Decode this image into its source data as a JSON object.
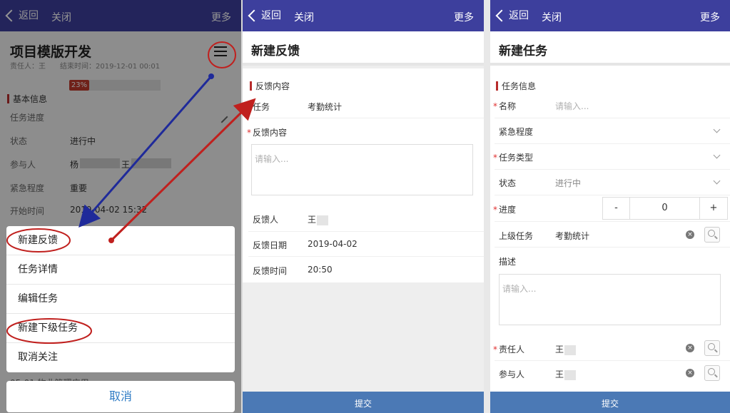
{
  "nav": {
    "back_label": "返回",
    "close_label": "关闭",
    "more_label": "更多"
  },
  "panel1": {
    "project_title": "项目模版开发",
    "meta_text": "责任人：王　　结束时间：2019-12-01 00:01",
    "section_basic": "基本信息",
    "rows": {
      "progress_label": "任务进度",
      "progress_value": "23%",
      "status_label": "状态",
      "status_value": "进行中",
      "participants_label": "参与人",
      "participants_value": "杨",
      "participants_value2": "王",
      "urgency_label": "紧急程度",
      "urgency_value": "重要",
      "start_label": "开始时间",
      "start_value": "2019-04-02 15:32"
    },
    "hidden_row": "05-01 物业管理应用",
    "action_sheet": {
      "items": [
        "新建反馈",
        "任务详情",
        "编辑任务",
        "新建下级任务",
        "取消关注"
      ],
      "cancel_label": "取消"
    }
  },
  "panel2": {
    "title": "新建反馈",
    "section": "反馈内容",
    "task_label": "任务",
    "task_value": "考勤统计",
    "content_label": "反馈内容",
    "content_placeholder": "请输入...",
    "feedback_person_label": "反馈人",
    "feedback_person_value": "王",
    "feedback_date_label": "反馈日期",
    "feedback_date_value": "2019-04-02",
    "feedback_time_label": "反馈时间",
    "feedback_time_value": "20:50",
    "submit_label": "提交"
  },
  "panel3": {
    "title": "新建任务",
    "section": "任务信息",
    "name_label": "名称",
    "name_placeholder": "请输入...",
    "urgency_label": "紧急程度",
    "type_label": "任务类型",
    "status_label": "状态",
    "status_value": "进行中",
    "progress_label": "进度",
    "progress_minus": "-",
    "progress_value": "0",
    "progress_plus": "+",
    "parent_label": "上级任务",
    "parent_value": "考勤统计",
    "desc_label": "描述",
    "desc_placeholder": "请输入...",
    "owner_label": "责任人",
    "owner_value": "王",
    "participant_label": "参与人",
    "participant_value": "王",
    "submit_label": "提交"
  },
  "annotation_color_red": "#c0201e",
  "annotation_color_blue": "#1f2a9a"
}
